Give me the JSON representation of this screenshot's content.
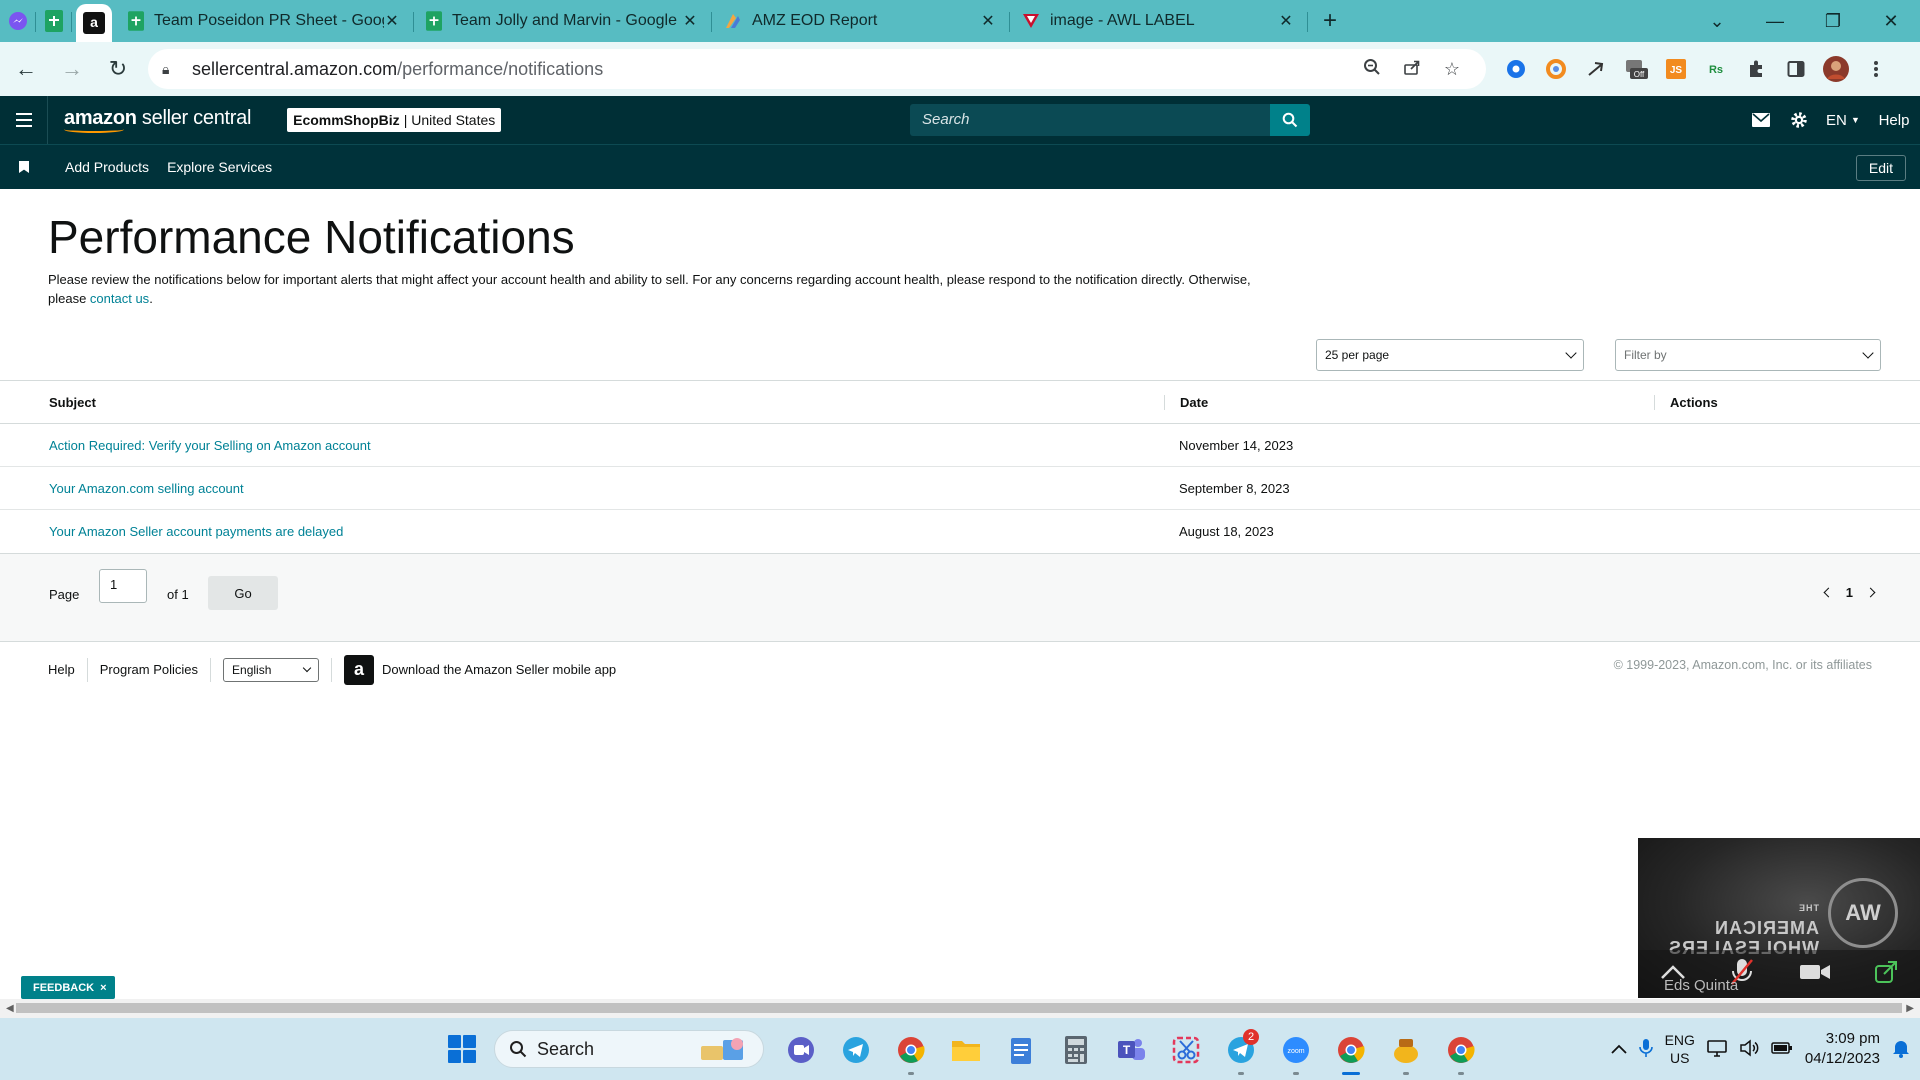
{
  "browser": {
    "tabs": [
      {
        "title": "Team Poseidon PR Sheet - Goog",
        "icon": "google-sheets-icon"
      },
      {
        "title": "Team Jolly and Marvin - Google",
        "icon": "google-sheets-icon"
      },
      {
        "title": "AMZ EOD Report",
        "icon": "report-icon"
      },
      {
        "title": "image - AWL LABEL",
        "icon": "awl-icon"
      }
    ],
    "url_domain": "sellercentral.amazon.com",
    "url_path": "/performance/notifications"
  },
  "header": {
    "logo_brand": "amazon",
    "logo_product": " seller central",
    "store_name": "EcommShopBiz",
    "marketplace": " | United States",
    "search_placeholder": "Search",
    "language": "EN",
    "help": "Help"
  },
  "subnav": {
    "links": [
      "Add Products",
      "Explore Services"
    ],
    "edit": "Edit"
  },
  "page": {
    "title": "Performance Notifications",
    "intro_text": "Please review the notifications below for important alerts that might affect your account health and ability to sell. For any concerns regarding account health, please respond to the notification directly. Otherwise, please ",
    "intro_link": "contact us",
    "intro_end": "."
  },
  "controls": {
    "per_page": "25 per page",
    "filter_placeholder": "Filter by"
  },
  "table": {
    "headers": {
      "subject": "Subject",
      "date": "Date",
      "actions": "Actions"
    },
    "rows": [
      {
        "subject": "Action Required: Verify your Selling on Amazon account",
        "date": "November 14, 2023"
      },
      {
        "subject": "Your Amazon.com selling account",
        "date": "September 8, 2023"
      },
      {
        "subject": "Your Amazon Seller account payments are delayed",
        "date": "August 18, 2023"
      }
    ]
  },
  "pagination": {
    "page_label": "Page",
    "current": "1",
    "of_label": "of 1",
    "go": "Go",
    "nav_page": "1"
  },
  "footer": {
    "help": "Help",
    "policies": "Program Policies",
    "language": "English",
    "app_text": "Download the Amazon Seller mobile app",
    "copyright": "© 1999-2023, Amazon.com, Inc. or its affiliates"
  },
  "feedback": {
    "label": "FEEDBACK",
    "close": "×"
  },
  "overlay": {
    "brand_line1": "THE",
    "brand_line2": "AMERICAN",
    "brand_line3": "WHOLESALERS",
    "emblem": "AW",
    "participant": "Eds Quinta"
  },
  "taskbar": {
    "search_label": "Search",
    "telegram_badge": "2",
    "lang_line1": "ENG",
    "lang_line2": "US",
    "time": "3:09 pm",
    "date": "04/12/2023"
  },
  "colors": {
    "tabstrip": "#57bcc2",
    "header_bg": "#002f36",
    "link": "#008296",
    "accent": "#00818a"
  }
}
